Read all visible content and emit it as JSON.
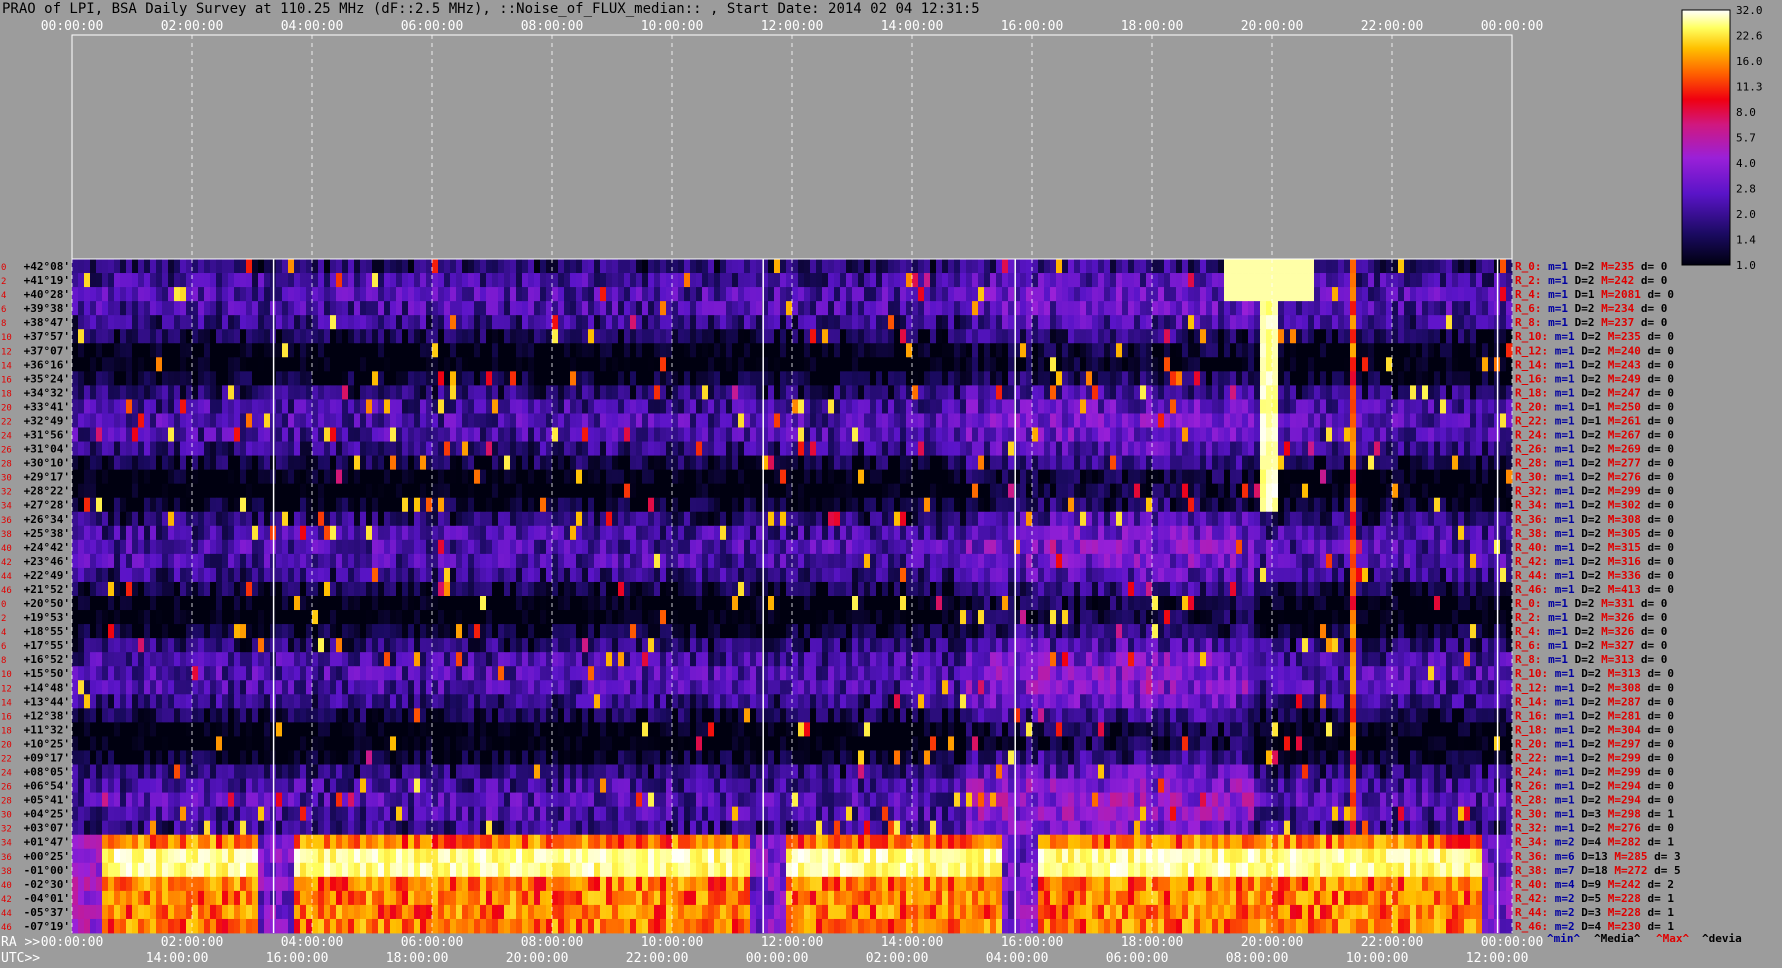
{
  "chart_data": {
    "type": "heatmap",
    "title": "PRAO of LPI, BSA Daily Survey at 110.25 MHz (dF::2.5 MHz), ::Noise_of_FLUX_median:: , Start Date: 2014 02 04 12:31:5",
    "x_top_ticks": [
      "00:00:00",
      "02:00:00",
      "04:00:00",
      "06:00:00",
      "08:00:00",
      "10:00:00",
      "12:00:00",
      "14:00:00",
      "16:00:00",
      "18:00:00",
      "20:00:00",
      "22:00:00",
      "00:00:00"
    ],
    "x_bottom_ra_label": "RA >>",
    "x_bottom_ra_ticks": [
      "00:00:00",
      "02:00:00",
      "04:00:00",
      "06:00:00",
      "08:00:00",
      "10:00:00",
      "12:00:00",
      "14:00:00",
      "16:00:00",
      "18:00:00",
      "20:00:00",
      "22:00:00",
      "00:00:00"
    ],
    "x_bottom_utc_label": "UTC>>",
    "x_bottom_utc_ticks": [
      "14:00:00",
      "16:00:00",
      "18:00:00",
      "20:00:00",
      "22:00:00",
      "00:00:00",
      "02:00:00",
      "04:00:00",
      "06:00:00",
      "08:00:00",
      "10:00:00",
      "12:00:00"
    ],
    "row_index_labels": [
      "0",
      "2",
      "4",
      "6",
      "8",
      "10",
      "12",
      "14",
      "16",
      "18",
      "20",
      "22",
      "24",
      "26",
      "28",
      "30",
      "32",
      "34",
      "36",
      "38",
      "40",
      "42",
      "44",
      "46",
      "0",
      "2",
      "4",
      "6",
      "8",
      "10",
      "12",
      "14",
      "16",
      "18",
      "20",
      "22",
      "24",
      "26",
      "28",
      "30",
      "32",
      "34",
      "36",
      "38",
      "40",
      "42",
      "44",
      "46"
    ],
    "declinations": [
      "+42°08'",
      "+41°19'",
      "+40°28'",
      "+39°38'",
      "+38°47'",
      "+37°57'",
      "+37°07'",
      "+36°16'",
      "+35°24'",
      "+34°32'",
      "+33°41'",
      "+32°49'",
      "+31°56'",
      "+31°04'",
      "+30°10'",
      "+29°17'",
      "+28°22'",
      "+27°28'",
      "+26°34'",
      "+25°38'",
      "+24°42'",
      "+23°46'",
      "+22°49'",
      "+21°52'",
      "+20°50'",
      "+19°53'",
      "+18°55'",
      "+17°55'",
      "+16°52'",
      "+15°50'",
      "+14°48'",
      "+13°44'",
      "+12°38'",
      "+11°32'",
      "+10°25'",
      "+09°17'",
      "+08°05'",
      "+06°54'",
      "+05°41'",
      "+04°25'",
      "+03°07'",
      "+01°47'",
      "+00°25'",
      "-01°00'",
      "-02°30'",
      "-04°01'",
      "-05°37'",
      "-07°19'"
    ],
    "row_stats": [
      {
        "r": "R_0:",
        "m": "m=1",
        "D": "D=2",
        "M": "M=235",
        "d": "d= 0"
      },
      {
        "r": "R_2:",
        "m": "m=1",
        "D": "D=2",
        "M": "M=242",
        "d": "d= 0"
      },
      {
        "r": "R_4:",
        "m": "m=1",
        "D": "D=1",
        "M": "M=2081",
        "d": "d= 0"
      },
      {
        "r": "R_6:",
        "m": "m=1",
        "D": "D=2",
        "M": "M=234",
        "d": "d= 0"
      },
      {
        "r": "R_8:",
        "m": "m=1",
        "D": "D=2",
        "M": "M=237",
        "d": "d= 0"
      },
      {
        "r": "R_10:",
        "m": "m=1",
        "D": "D=2",
        "M": "M=235",
        "d": "d= 0"
      },
      {
        "r": "R_12:",
        "m": "m=1",
        "D": "D=2",
        "M": "M=240",
        "d": "d= 0"
      },
      {
        "r": "R_14:",
        "m": "m=1",
        "D": "D=2",
        "M": "M=243",
        "d": "d= 0"
      },
      {
        "r": "R_16:",
        "m": "m=1",
        "D": "D=2",
        "M": "M=249",
        "d": "d= 0"
      },
      {
        "r": "R_18:",
        "m": "m=1",
        "D": "D=2",
        "M": "M=247",
        "d": "d= 0"
      },
      {
        "r": "R_20:",
        "m": "m=1",
        "D": "D=1",
        "M": "M=250",
        "d": "d= 0"
      },
      {
        "r": "R_22:",
        "m": "m=1",
        "D": "D=1",
        "M": "M=261",
        "d": "d= 0"
      },
      {
        "r": "R_24:",
        "m": "m=1",
        "D": "D=2",
        "M": "M=267",
        "d": "d= 0"
      },
      {
        "r": "R_26:",
        "m": "m=1",
        "D": "D=2",
        "M": "M=269",
        "d": "d= 0"
      },
      {
        "r": "R_28:",
        "m": "m=1",
        "D": "D=2",
        "M": "M=277",
        "d": "d= 0"
      },
      {
        "r": "R_30:",
        "m": "m=1",
        "D": "D=2",
        "M": "M=276",
        "d": "d= 0"
      },
      {
        "r": "R_32:",
        "m": "m=1",
        "D": "D=2",
        "M": "M=299",
        "d": "d= 0"
      },
      {
        "r": "R_34:",
        "m": "m=1",
        "D": "D=2",
        "M": "M=302",
        "d": "d= 0"
      },
      {
        "r": "R_36:",
        "m": "m=1",
        "D": "D=2",
        "M": "M=308",
        "d": "d= 0"
      },
      {
        "r": "R_38:",
        "m": "m=1",
        "D": "D=2",
        "M": "M=305",
        "d": "d= 0"
      },
      {
        "r": "R_40:",
        "m": "m=1",
        "D": "D=2",
        "M": "M=315",
        "d": "d= 0"
      },
      {
        "r": "R_42:",
        "m": "m=1",
        "D": "D=2",
        "M": "M=316",
        "d": "d= 0"
      },
      {
        "r": "R_44:",
        "m": "m=1",
        "D": "D=2",
        "M": "M=336",
        "d": "d= 0"
      },
      {
        "r": "R_46:",
        "m": "m=1",
        "D": "D=2",
        "M": "M=413",
        "d": "d= 0"
      },
      {
        "r": "R_0:",
        "m": "m=1",
        "D": "D=2",
        "M": "M=331",
        "d": "d= 0"
      },
      {
        "r": "R_2:",
        "m": "m=1",
        "D": "D=2",
        "M": "M=326",
        "d": "d= 0"
      },
      {
        "r": "R_4:",
        "m": "m=1",
        "D": "D=2",
        "M": "M=326",
        "d": "d= 0"
      },
      {
        "r": "R_6:",
        "m": "m=1",
        "D": "D=2",
        "M": "M=327",
        "d": "d= 0"
      },
      {
        "r": "R_8:",
        "m": "m=1",
        "D": "D=2",
        "M": "M=313",
        "d": "d= 0"
      },
      {
        "r": "R_10:",
        "m": "m=1",
        "D": "D=2",
        "M": "M=313",
        "d": "d= 0"
      },
      {
        "r": "R_12:",
        "m": "m=1",
        "D": "D=2",
        "M": "M=308",
        "d": "d= 0"
      },
      {
        "r": "R_14:",
        "m": "m=1",
        "D": "D=2",
        "M": "M=287",
        "d": "d= 0"
      },
      {
        "r": "R_16:",
        "m": "m=1",
        "D": "D=2",
        "M": "M=281",
        "d": "d= 0"
      },
      {
        "r": "R_18:",
        "m": "m=1",
        "D": "D=2",
        "M": "M=304",
        "d": "d= 0"
      },
      {
        "r": "R_20:",
        "m": "m=1",
        "D": "D=2",
        "M": "M=297",
        "d": "d= 0"
      },
      {
        "r": "R_22:",
        "m": "m=1",
        "D": "D=2",
        "M": "M=299",
        "d": "d= 0"
      },
      {
        "r": "R_24:",
        "m": "m=1",
        "D": "D=2",
        "M": "M=299",
        "d": "d= 0"
      },
      {
        "r": "R_26:",
        "m": "m=1",
        "D": "D=2",
        "M": "M=294",
        "d": "d= 0"
      },
      {
        "r": "R_28:",
        "m": "m=1",
        "D": "D=2",
        "M": "M=294",
        "d": "d= 0"
      },
      {
        "r": "R_30:",
        "m": "m=1",
        "D": "D=3",
        "M": "M=298",
        "d": "d= 1"
      },
      {
        "r": "R_32:",
        "m": "m=1",
        "D": "D=2",
        "M": "M=276",
        "d": "d= 0"
      },
      {
        "r": "R_34:",
        "m": "m=2",
        "D": "D=4",
        "M": "M=282",
        "d": "d= 1"
      },
      {
        "r": "R_36:",
        "m": "m=6",
        "D": "D=13",
        "M": "M=285",
        "d": "d= 3"
      },
      {
        "r": "R_38:",
        "m": "m=7",
        "D": "D=18",
        "M": "M=272",
        "d": "d= 5"
      },
      {
        "r": "R_40:",
        "m": "m=4",
        "D": "D=9",
        "M": "M=242",
        "d": "d= 2"
      },
      {
        "r": "R_42:",
        "m": "m=2",
        "D": "D=5",
        "M": "M=228",
        "d": "d= 1"
      },
      {
        "r": "R_44:",
        "m": "m=2",
        "D": "D=3",
        "M": "M=228",
        "d": "d= 1"
      },
      {
        "r": "R_46:",
        "m": "m=2",
        "D": "D=4",
        "M": "M=230",
        "d": "d= 1"
      }
    ],
    "stats_legend": [
      "^min^",
      "^Media^",
      "^Max^",
      "^devia"
    ],
    "colorbar": {
      "labels": [
        "32.0",
        "22.6",
        "16.0",
        "11.3",
        "8.0",
        "5.7",
        "4.0",
        "2.8",
        "2.0",
        "1.4",
        "1.0"
      ],
      "scale": "log",
      "range": [
        1.0,
        32.0
      ]
    },
    "features": {
      "bright_band_rows": [
        41,
        42,
        43,
        44,
        45,
        46,
        47
      ],
      "bright_band_value": 30,
      "bright_source_ra": "20:00:00",
      "bright_source_dec": "+41°19'",
      "background_value": 2.0
    },
    "colors": {
      "background": "#9c9c9c",
      "heat_low": "#0a0a3c",
      "heat_mid": "#8a1ee0",
      "heat_high": "#ffff60",
      "heat_max": "#ffffff",
      "label_red": "#e00000",
      "label_blue": "#0000a0"
    }
  }
}
